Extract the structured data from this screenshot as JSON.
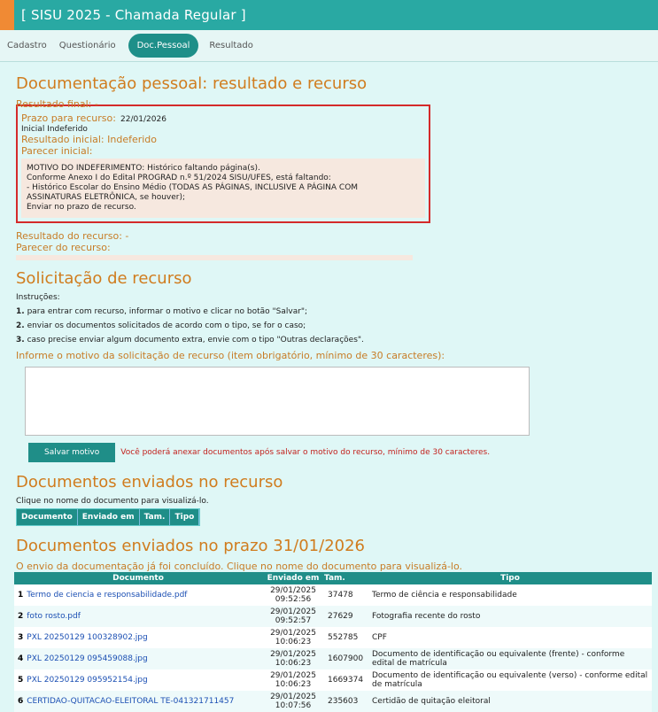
{
  "app": {
    "title": "[ SISU 2025 - Chamada Regular ]"
  },
  "tabs": [
    "Cadastro",
    "Questionário",
    "Doc.Pessoal",
    "Resultado"
  ],
  "section1": {
    "heading": "Documentação pessoal: resultado e recurso",
    "resultado_final_label": "Resultado final: -",
    "prazo_label": "Prazo para recurso:",
    "prazo_value": "22/01/2026",
    "inicial_indeferido": "Inicial Indeferido",
    "resultado_inicial": "Resultado inicial: Indeferido",
    "parecer_label": "Parecer inicial:",
    "parecer_lines": [
      "MOTIVO DO INDEFERIMENTO: Histórico faltando página(s).",
      "Conforme Anexo I do Edital PROGRAD n.º 51/2024 SISU/UFES, está faltando:",
      "- Histórico Escolar do Ensino Médio (TODAS AS PÁGINAS, INCLUSIVE A PÁGINA COM",
      "ASSINATURAS ELETRÔNICA, se houver);",
      "Enviar no prazo de recurso."
    ],
    "resultado_recurso": "Resultado do recurso: -",
    "parecer_recurso": "Parecer do recurso:"
  },
  "section2": {
    "heading": "Solicitação de recurso",
    "instrucoes": "Instruções:",
    "steps": [
      {
        "n": "1.",
        "t": "para entrar com recurso, informar o motivo e clicar no botão \"Salvar\";"
      },
      {
        "n": "2.",
        "t": "enviar os documentos solicitados de acordo com o tipo, se for o caso;"
      },
      {
        "n": "3.",
        "t": "caso precise enviar algum documento extra, envie com o tipo \"Outras declarações\"."
      }
    ],
    "motivo_label": "Informe o motivo da solicitação de recurso (item obrigatório, mínimo de 30 caracteres):",
    "salvar_button": "Salvar motivo",
    "warning": "Você poderá anexar documentos após salvar o motivo do recurso, mínimo de 30 caracteres."
  },
  "section3": {
    "heading": "Documentos enviados no recurso",
    "hint": "Clique no nome do documento para visualizá-lo.",
    "columns": [
      "Documento",
      "Enviado em",
      "Tam.",
      "Tipo"
    ]
  },
  "section4": {
    "heading": "Documentos enviados no prazo 31/01/2026",
    "note": "O envio da documentação já foi concluído. Clique no nome do documento para visualizá-lo.",
    "columns": [
      "Documento",
      "Enviado em",
      "Tam.",
      "Tipo"
    ],
    "rows": [
      {
        "n": "1",
        "doc": "Termo de ciencia e responsabilidade.pdf",
        "date": "29/01/2025",
        "time": "09:52:56",
        "size": "37478",
        "tipo": "Termo de ciência e responsabilidade"
      },
      {
        "n": "2",
        "doc": "foto rosto.pdf",
        "date": "29/01/2025",
        "time": "09:52:57",
        "size": "27629",
        "tipo": "Fotografia recente do rosto"
      },
      {
        "n": "3",
        "doc": "PXL 20250129 100328902.jpg",
        "date": "29/01/2025",
        "time": "10:06:23",
        "size": "552785",
        "tipo": "CPF"
      },
      {
        "n": "4",
        "doc": "PXL 20250129 095459088.jpg",
        "date": "29/01/2025",
        "time": "10:06:23",
        "size": "1607900",
        "tipo": "Documento de identificação ou equivalente (frente) - conforme edital de matrícula"
      },
      {
        "n": "5",
        "doc": "PXL 20250129 095952154.jpg",
        "date": "29/01/2025",
        "time": "10:06:23",
        "size": "1669374",
        "tipo": "Documento de identificação ou equivalente (verso) - conforme edital de matrícula"
      },
      {
        "n": "6",
        "doc": "CERTIDAO-QUITACAO-ELEITORAL TE-041321711457",
        "date": "29/01/2025",
        "time": "10:07:56",
        "size": "235603",
        "tipo": "Certidão de quitação eleitoral"
      }
    ]
  }
}
